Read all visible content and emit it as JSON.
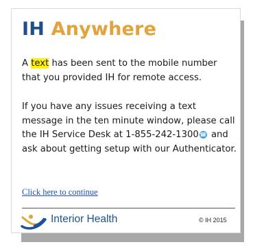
{
  "logo": {
    "ih": "IH",
    "anywhere": "Anywhere"
  },
  "message": {
    "p1_before": "A ",
    "p1_highlight": "text",
    "p1_after": " has been sent to the mobile number that you provided IH for remote access.",
    "p2_before": "If you have any issues receiving a text message in the ten minute window, please call the IH Service Desk at 1-855-242-1300",
    "p2_after": " and ask about getting setup with our Authenticator."
  },
  "link": {
    "label": "Click here to continue"
  },
  "footer": {
    "organization": "Interior Health",
    "copyright": "© IH 2015"
  },
  "colors": {
    "logo_ih": "#1f4e8c",
    "logo_anywhere": "#e3a33a",
    "highlight": "#fff200",
    "link": "#1a4fd6",
    "footer_text": "#1e4f9a"
  },
  "icons": {
    "phone_badge": "skype-call-icon",
    "org_logo": "interior-health-swoosh-icon"
  }
}
